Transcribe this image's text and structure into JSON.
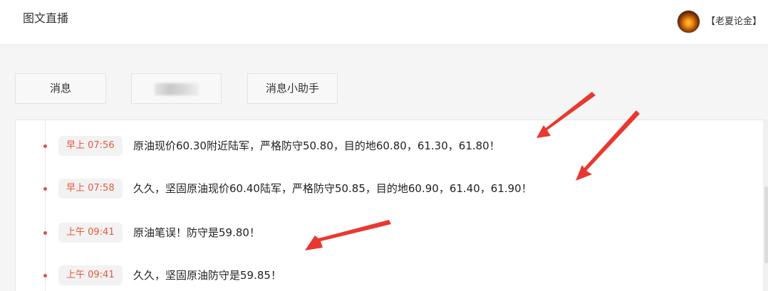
{
  "header": {
    "title": "图文直播",
    "username": "【老夏论金】"
  },
  "tabs": [
    {
      "label": "消息"
    },
    {
      "label": ""
    },
    {
      "label": "消息小助手"
    }
  ],
  "feed": {
    "entries": [
      {
        "time": "早上 07:56",
        "text": "原油现价60.30附近陆军，严格防守50.80，目的地60.80，61.30，61.80！"
      },
      {
        "time": "早上 07:58",
        "text": "久久，坚固原油现价60.40陆军，严格防守50.85，目的地60.90，61.40，61.90！"
      },
      {
        "time": "上午 09:41",
        "text": "原油笔误！防守是59.80！"
      },
      {
        "time": "上午 09:41",
        "text": "久久，坚固原油防守是59.85！"
      }
    ]
  },
  "colors": {
    "accent_time": "#e55a3c",
    "annotation_arrow": "#e8382f",
    "timeline_dot": "#e04f4f"
  }
}
